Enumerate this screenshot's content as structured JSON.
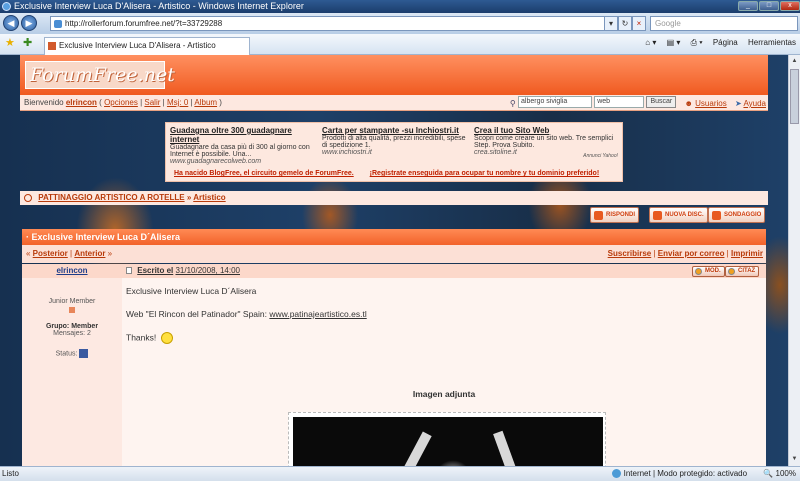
{
  "window": {
    "title": "Exclusive Interview Luca D'Alisera - Artistico - Windows Internet Explorer"
  },
  "address": {
    "url": "http://rollerforum.forumfree.net/?t=33729288",
    "search_placeholder": "Google"
  },
  "tab": {
    "label": "Exclusive Interview Luca D'Alisera - Artistico"
  },
  "tools": {
    "page": "Página",
    "tools": "Herramientas"
  },
  "forum": {
    "logo": "ForumFree.net",
    "welcome": "Bienvenido",
    "username": "elrincon",
    "links": [
      "Opciones",
      "Salir",
      "Msj: 0",
      "Album"
    ],
    "search_value": "albergo siviglia",
    "search_scope": "web",
    "search_button": "Buscar",
    "users_link": "Usuarios",
    "help_link": "Ayuda"
  },
  "ads": [
    {
      "title": "Guadagna oltre 300 guadagnare internet",
      "text": "Guadagnare da casa più di 300 al giorno con Internet è possibile. Una...",
      "url": "www.guadagnarecolweb.com"
    },
    {
      "title": "Carta per stampante -su Inchiostri.it",
      "text": "Prodotti di alta qualità, prezzi incredibili, spese di spedizione 1.",
      "url": "www.inchiostri.it"
    },
    {
      "title": "Crea il tuo Sito Web",
      "text": "Scopri come creare un sito web. Tre semplici Step. Prova Subito.",
      "url": "crea.sitoline.it"
    }
  ],
  "ad_credit": "Annunci Yahoo!",
  "ad_footer": [
    "Ha nacido BlogFree, el circuito gemelo de ForumFree.",
    "¡Registrate enseguida para ocupar tu nombre y tu dominio preferido!"
  ],
  "breadcrumb": {
    "section": "PATTINAGGIO ARTISTICO A ROTELLE",
    "sep": "»",
    "forum": "Artistico"
  },
  "actions": {
    "reply": "RISPONDI",
    "new": "NUOVA DISC.",
    "poll": "SONDAGGIO"
  },
  "topic": {
    "title": "Exclusive Interview Luca D´Alisera"
  },
  "postnav": {
    "prev": "Posterior",
    "next": "Anterior",
    "subscribe": "Suscribirse",
    "email": "Enviar por correo",
    "print": "Imprimir"
  },
  "post": {
    "author": "elrincon",
    "rank": "Junior Member",
    "group": "Grupo: Member",
    "messages": "Mensajes: 2",
    "status": "Status:",
    "written": "Escrito el",
    "date": "31/10/2008, 14:00",
    "mod_btn": "MOD.",
    "quote_btn": "CITAZ",
    "line1": "Exclusive Interview Luca D´Alisera",
    "line2_prefix": "Web \"El Rincon del Patinador\" Spain: ",
    "line2_link": "www.patinajeartistico.es.tl",
    "line3": "Thanks!",
    "attachment": "Imagen adjunta"
  },
  "statusbar": {
    "left": "Listo",
    "zone": "Internet | Modo protegido: activado",
    "zoom": "100%"
  }
}
